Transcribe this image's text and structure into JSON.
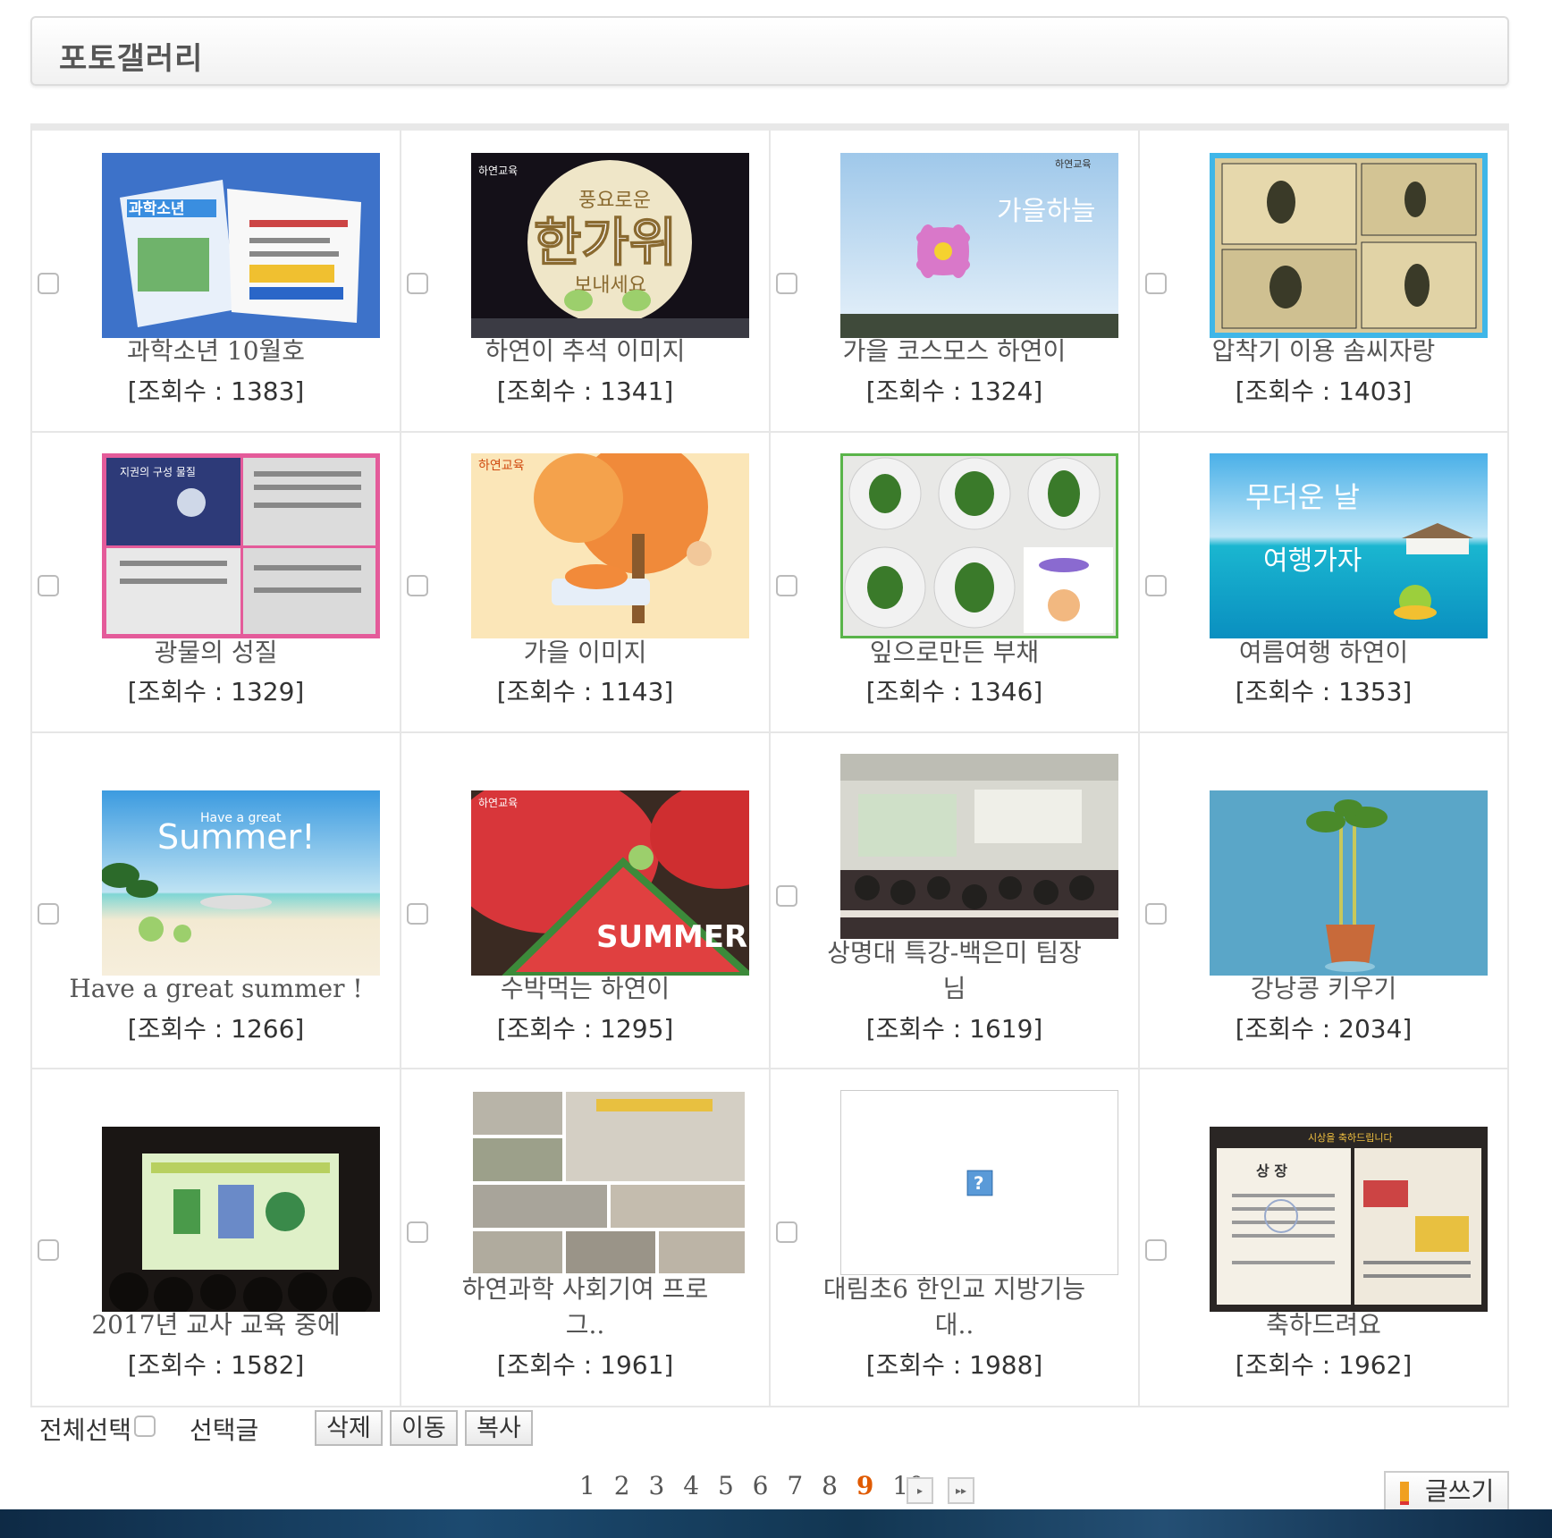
{
  "page": {
    "title": "포토갤러리"
  },
  "gallery": {
    "rows": [
      {
        "items": [
          {
            "caption": "과학소년 10월호",
            "views": "[조회수 : 1383]"
          },
          {
            "caption": "하연이 추석 이미지",
            "views": "[조회수 : 1341]"
          },
          {
            "caption": "가을 코스모스 하연이",
            "views": "[조회수 : 1324]"
          },
          {
            "caption": "압착기 이용 솜씨자랑",
            "views": "[조회수 : 1403]"
          }
        ]
      },
      {
        "items": [
          {
            "caption": "광물의 성질",
            "views": "[조회수 : 1329]"
          },
          {
            "caption": "가을 이미지",
            "views": "[조회수 : 1143]"
          },
          {
            "caption": "잎으로만든 부채",
            "views": "[조회수 : 1346]"
          },
          {
            "caption": "여름여행 하연이",
            "views": "[조회수 : 1353]"
          }
        ]
      },
      {
        "items": [
          {
            "caption": "Have a great summer !",
            "views": "[조회수 : 1266]"
          },
          {
            "caption": "수박먹는 하연이",
            "views": "[조회수 : 1295]"
          },
          {
            "caption": "상명대 특강-백은미 팀장",
            "caption2": "님",
            "views": "[조회수 : 1619]"
          },
          {
            "caption": "강낭콩 키우기",
            "views": "[조회수 : 2034]"
          }
        ]
      },
      {
        "items": [
          {
            "caption": "2017년 교사 교육 중에",
            "views": "[조회수 : 1582]"
          },
          {
            "caption": "하연과학 사회기여 프로",
            "caption2": "그..",
            "views": "[조회수 : 1961]"
          },
          {
            "caption": "대림초6 한인교 지방기능",
            "caption2": "대..",
            "views": "[조회수 : 1988]"
          },
          {
            "caption": "축하드려요",
            "views": "[조회수 : 1962]"
          }
        ]
      }
    ],
    "thumb_text": {
      "magazine": "과학소년",
      "chuseok_brand": "하연교육",
      "chuseok": "한가위",
      "chuseok_sub": "풍요로운",
      "chuseok_sub2": "보내세요",
      "cosmos_brand": "하연교육",
      "cosmos": "가을하늘",
      "mineral": "지권의 구성 물질",
      "autumn_brand": "하연교육",
      "travel": "무더운 날",
      "travel2": "여행가자",
      "summer_small": "Have a great",
      "summer": "Summer!",
      "watermelon_brand": "하연교육",
      "watermelon": "SUMMER",
      "award_banner": "시상을 축하드립니다",
      "award": "상 장",
      "broken": "?"
    }
  },
  "controls": {
    "select_all": "전체선택",
    "selected_posts": "선택글",
    "delete": "삭제",
    "move": "이동",
    "copy": "복사"
  },
  "pagination": {
    "pages": [
      "1",
      "2",
      "3",
      "4",
      "5",
      "6",
      "7",
      "8",
      "9",
      "10"
    ],
    "current": "9",
    "next_icon": "next-page-icon",
    "last_icon": "last-page-icon"
  },
  "write": {
    "label": "글쓰기",
    "icon": "pencil-icon"
  },
  "colors": {
    "current_page": "#e05a00",
    "border": "#e6e6e6"
  }
}
